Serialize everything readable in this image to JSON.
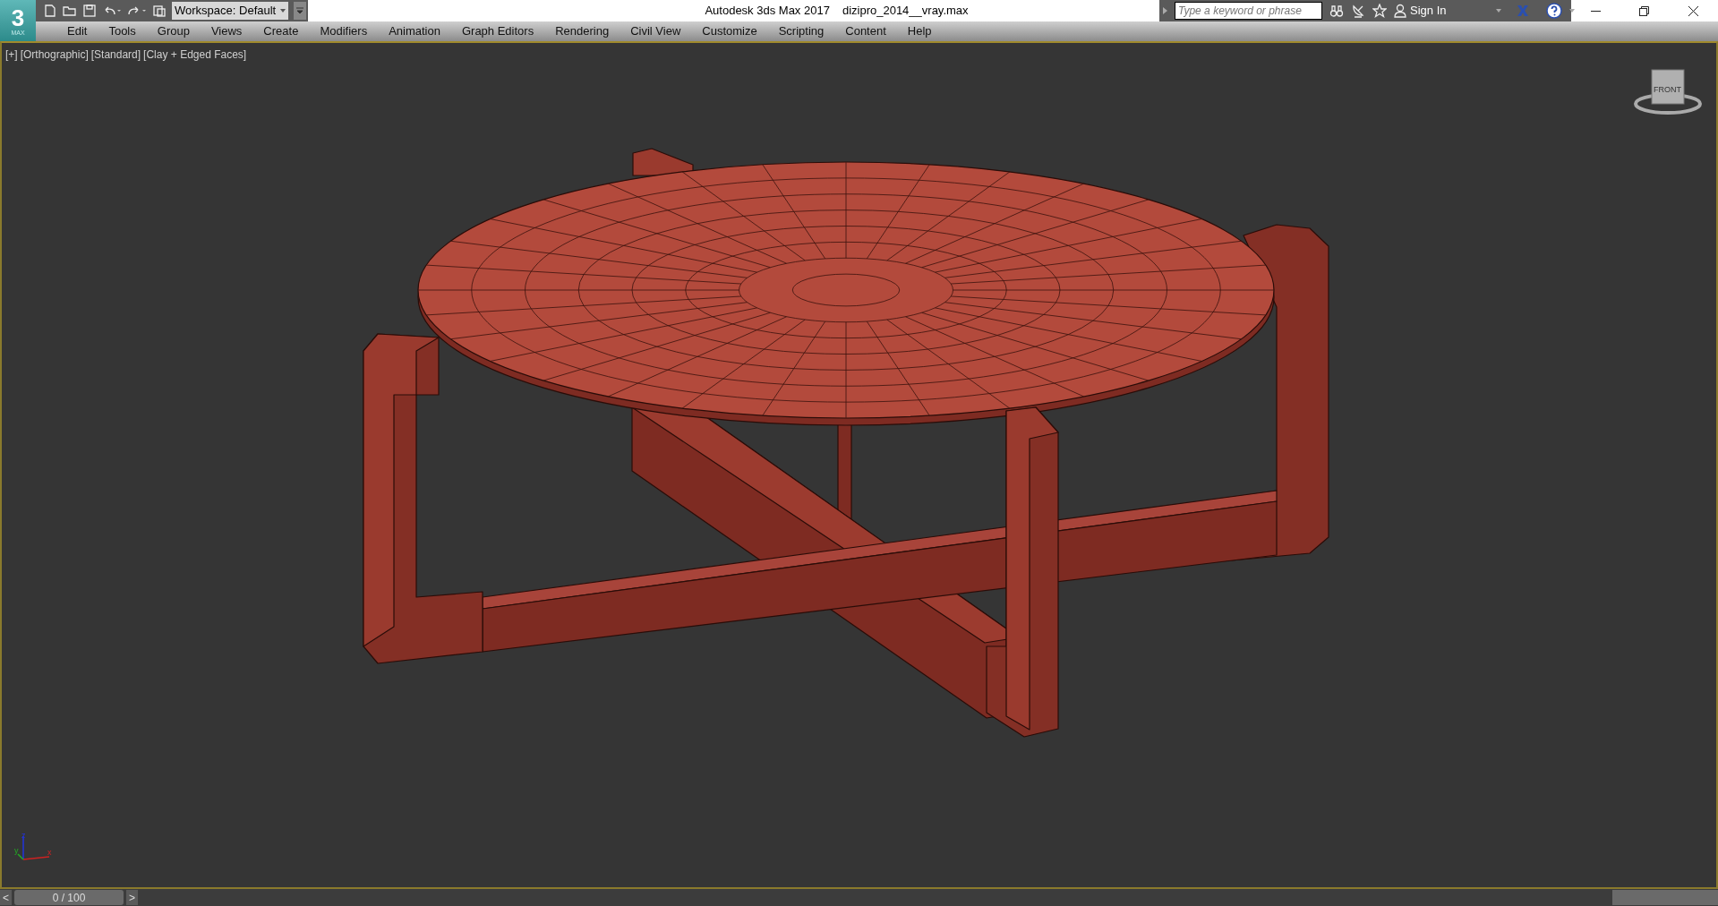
{
  "logo": {
    "text": "3",
    "subtext": "MAX"
  },
  "quick_access": {
    "workspace": "Workspace: Default"
  },
  "window": {
    "title": "Autodesk 3ds Max 2017",
    "file": "dizipro_2014__vray.max"
  },
  "search": {
    "placeholder": "Type a keyword or phrase"
  },
  "account": {
    "label": "Sign In"
  },
  "menu": [
    "Edit",
    "Tools",
    "Group",
    "Views",
    "Create",
    "Modifiers",
    "Animation",
    "Graph Editors",
    "Rendering",
    "Civil View",
    "Customize",
    "Scripting",
    "Content",
    "Help"
  ],
  "viewport": {
    "labels": [
      "[+]",
      "[Orthographic]",
      "[Standard]",
      "[Clay + Edged Faces]"
    ],
    "viewcube": "FRONT",
    "axes": {
      "z": "z",
      "y": "y",
      "x": "x"
    }
  },
  "timeline": {
    "prev": "<",
    "frame": "0 / 100",
    "level": 0,
    "next": ">"
  }
}
